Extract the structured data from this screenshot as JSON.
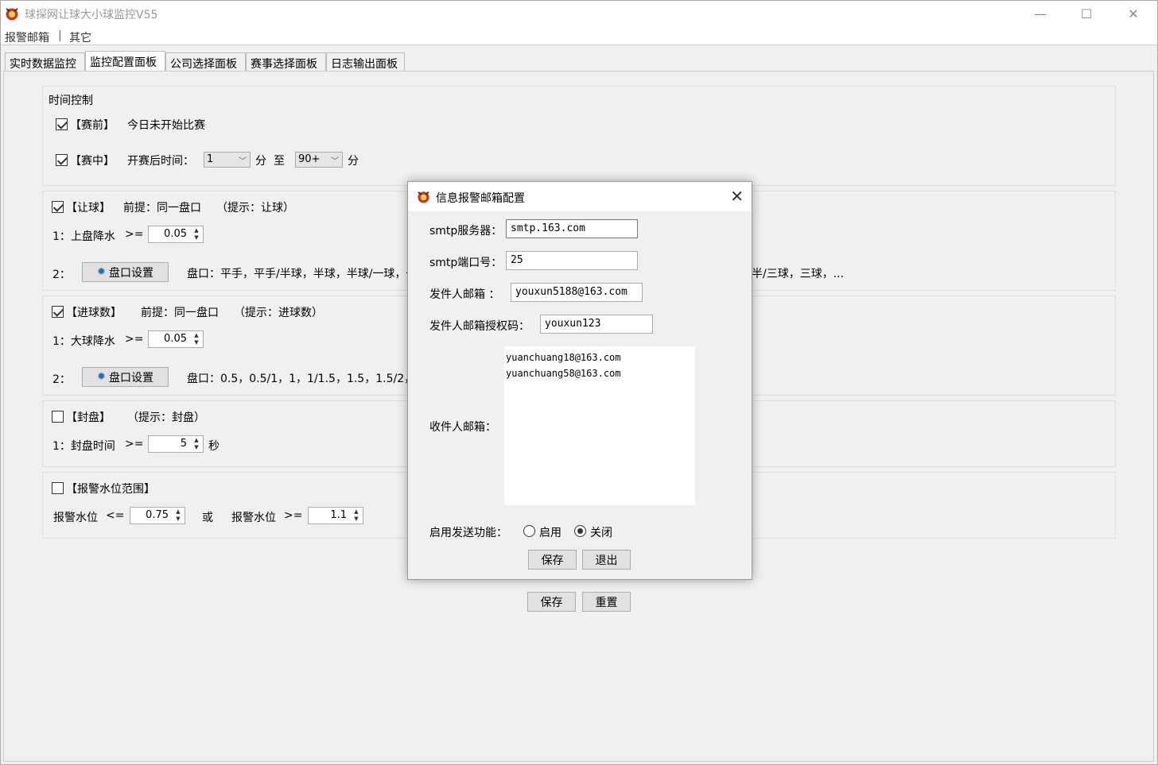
{
  "window": {
    "title": "球探网让球大小球监控V55"
  },
  "menu": {
    "items": [
      "报警邮箱",
      "|",
      "其它"
    ]
  },
  "tabs": [
    "实时数据监控",
    "监控配置面板",
    "公司选择面板",
    "赛事选择面板",
    "日志输出面板"
  ],
  "time_control": {
    "title": "时间控制",
    "pre": {
      "label": "【赛前】",
      "desc": "今日未开始比赛",
      "checked": true
    },
    "live": {
      "label": "【赛中】",
      "desc": "开赛后时间：",
      "from": "1",
      "unit1": "分",
      "to_label": "至",
      "to": "90+",
      "unit2": "分",
      "checked": true
    }
  },
  "handicap": {
    "label": "【让球】",
    "premise": "前提：同一盘口",
    "hint": "（提示：让球）",
    "checked": true,
    "row1_label": "1：上盘降水",
    "row1_op": ">=",
    "row1_value": "0.05",
    "row2_label": "2：",
    "button": "盘口设置",
    "lines_left": "盘口：平手，平手/半球，半球，半球/一球，一",
    "lines_right": "半/三球，三球，..."
  },
  "goals": {
    "label": "【进球数】",
    "premise": "前提：同一盘口",
    "hint": "（提示：进球数）",
    "checked": true,
    "row1_label": "1：大球降水",
    "row1_op": ">=",
    "row1_value": "0.05",
    "row2_label": "2：",
    "button": "盘口设置",
    "lines_left": "盘口：0.5，0.5/1，1，1/1.5，1.5，1.5/2，2，"
  },
  "closing": {
    "label": "【封盘】",
    "hint": "（提示：封盘）",
    "checked": false,
    "row1_label": "1：封盘时间",
    "row1_op": ">=",
    "row1_value": "5",
    "unit": "秒"
  },
  "alarm": {
    "label": "【报警水位范围】",
    "checked": false,
    "low_label": "报警水位",
    "low_op": "<=",
    "low_value": "0.75",
    "or": "或",
    "high_label": "报警水位",
    "high_op": ">=",
    "high_value": "1.1"
  },
  "main_buttons": {
    "save": "保存",
    "reset": "重置"
  },
  "dialog": {
    "title": "信息报警邮箱配置",
    "smtp_server_label": "smtp服务器：",
    "smtp_server": "smtp.163.com",
    "smtp_port_label": "smtp端口号：",
    "smtp_port": "25",
    "sender_label": "发件人邮箱 ：",
    "sender": "youxun5188@163.com",
    "auth_label": "发件人邮箱授权码：",
    "auth": "youxun123",
    "recipients_label": "收件人邮箱：",
    "recipients": [
      "yuanchuang18@163.com",
      "yuanchuang58@163.com"
    ],
    "enable_label": "启用发送功能：",
    "enable_on": "启用",
    "enable_off": "关闭",
    "enabled": false,
    "save": "保存",
    "exit": "退出"
  }
}
